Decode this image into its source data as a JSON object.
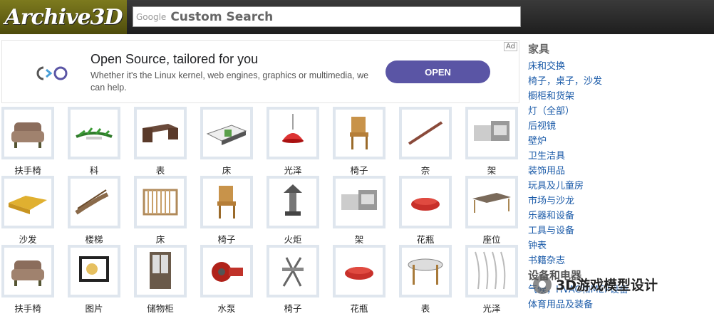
{
  "header": {
    "logo_text": "Archive3D",
    "search_brand": "Google",
    "search_placeholder": "Custom Search"
  },
  "ad": {
    "badge": "Ad",
    "title": "Open Source, tailored for you",
    "description": "Whether it's the Linux kernel, web engines, graphics or multimedia, we can help.",
    "button": "OPEN"
  },
  "grid": {
    "items": [
      {
        "label": "扶手椅",
        "icon": "armchair-icon"
      },
      {
        "label": "科",
        "icon": "plant-icon"
      },
      {
        "label": "表",
        "icon": "desk-icon"
      },
      {
        "label": "床",
        "icon": "bed-icon"
      },
      {
        "label": "光泽",
        "icon": "lamp-icon"
      },
      {
        "label": "椅子",
        "icon": "chair-icon"
      },
      {
        "label": "奈",
        "icon": "rod-icon"
      },
      {
        "label": "架",
        "icon": "shelf-icon"
      },
      {
        "label": "沙发",
        "icon": "sofa-icon"
      },
      {
        "label": "楼梯",
        "icon": "stairs-icon"
      },
      {
        "label": "床",
        "icon": "crib-icon"
      },
      {
        "label": "椅子",
        "icon": "chair-icon"
      },
      {
        "label": "火炬",
        "icon": "torch-lamp-icon"
      },
      {
        "label": "架",
        "icon": "shelf-icon"
      },
      {
        "label": "花瓶",
        "icon": "vase-icon"
      },
      {
        "label": "座位",
        "icon": "bench-icon"
      },
      {
        "label": "扶手椅",
        "icon": "armchair-icon"
      },
      {
        "label": "图片",
        "icon": "picture-icon"
      },
      {
        "label": "储物柜",
        "icon": "cabinet-icon"
      },
      {
        "label": "水泵",
        "icon": "pump-icon"
      },
      {
        "label": "椅子",
        "icon": "folding-chair-icon"
      },
      {
        "label": "花瓶",
        "icon": "vase-icon"
      },
      {
        "label": "表",
        "icon": "round-table-icon"
      },
      {
        "label": "光泽",
        "icon": "curtain-icon"
      }
    ]
  },
  "sidebar": {
    "heading": "家具",
    "items": [
      "床和交换",
      "椅子，桌子，沙发",
      "橱柜和货架",
      "灯（全部）",
      "后视镜",
      "壁炉",
      "卫生洁具",
      "装饰用品",
      "玩具及儿童房",
      "市场与沙龙",
      "乐器和设备",
      "工具与设备",
      "钟表",
      "书籍杂志"
    ],
    "heading2": "设备和电器",
    "items2": [
      "气候，HVAC和MEP设备",
      "体育用品及装备"
    ]
  },
  "watermark": {
    "text": "3D游戏模型设计"
  },
  "colors": {
    "header": "#2b2b2b",
    "logo_bg": "#6b6916",
    "ad_button": "#5a55a5",
    "link": "#1a5aa8",
    "thumb_border": "#dfe6ee"
  }
}
